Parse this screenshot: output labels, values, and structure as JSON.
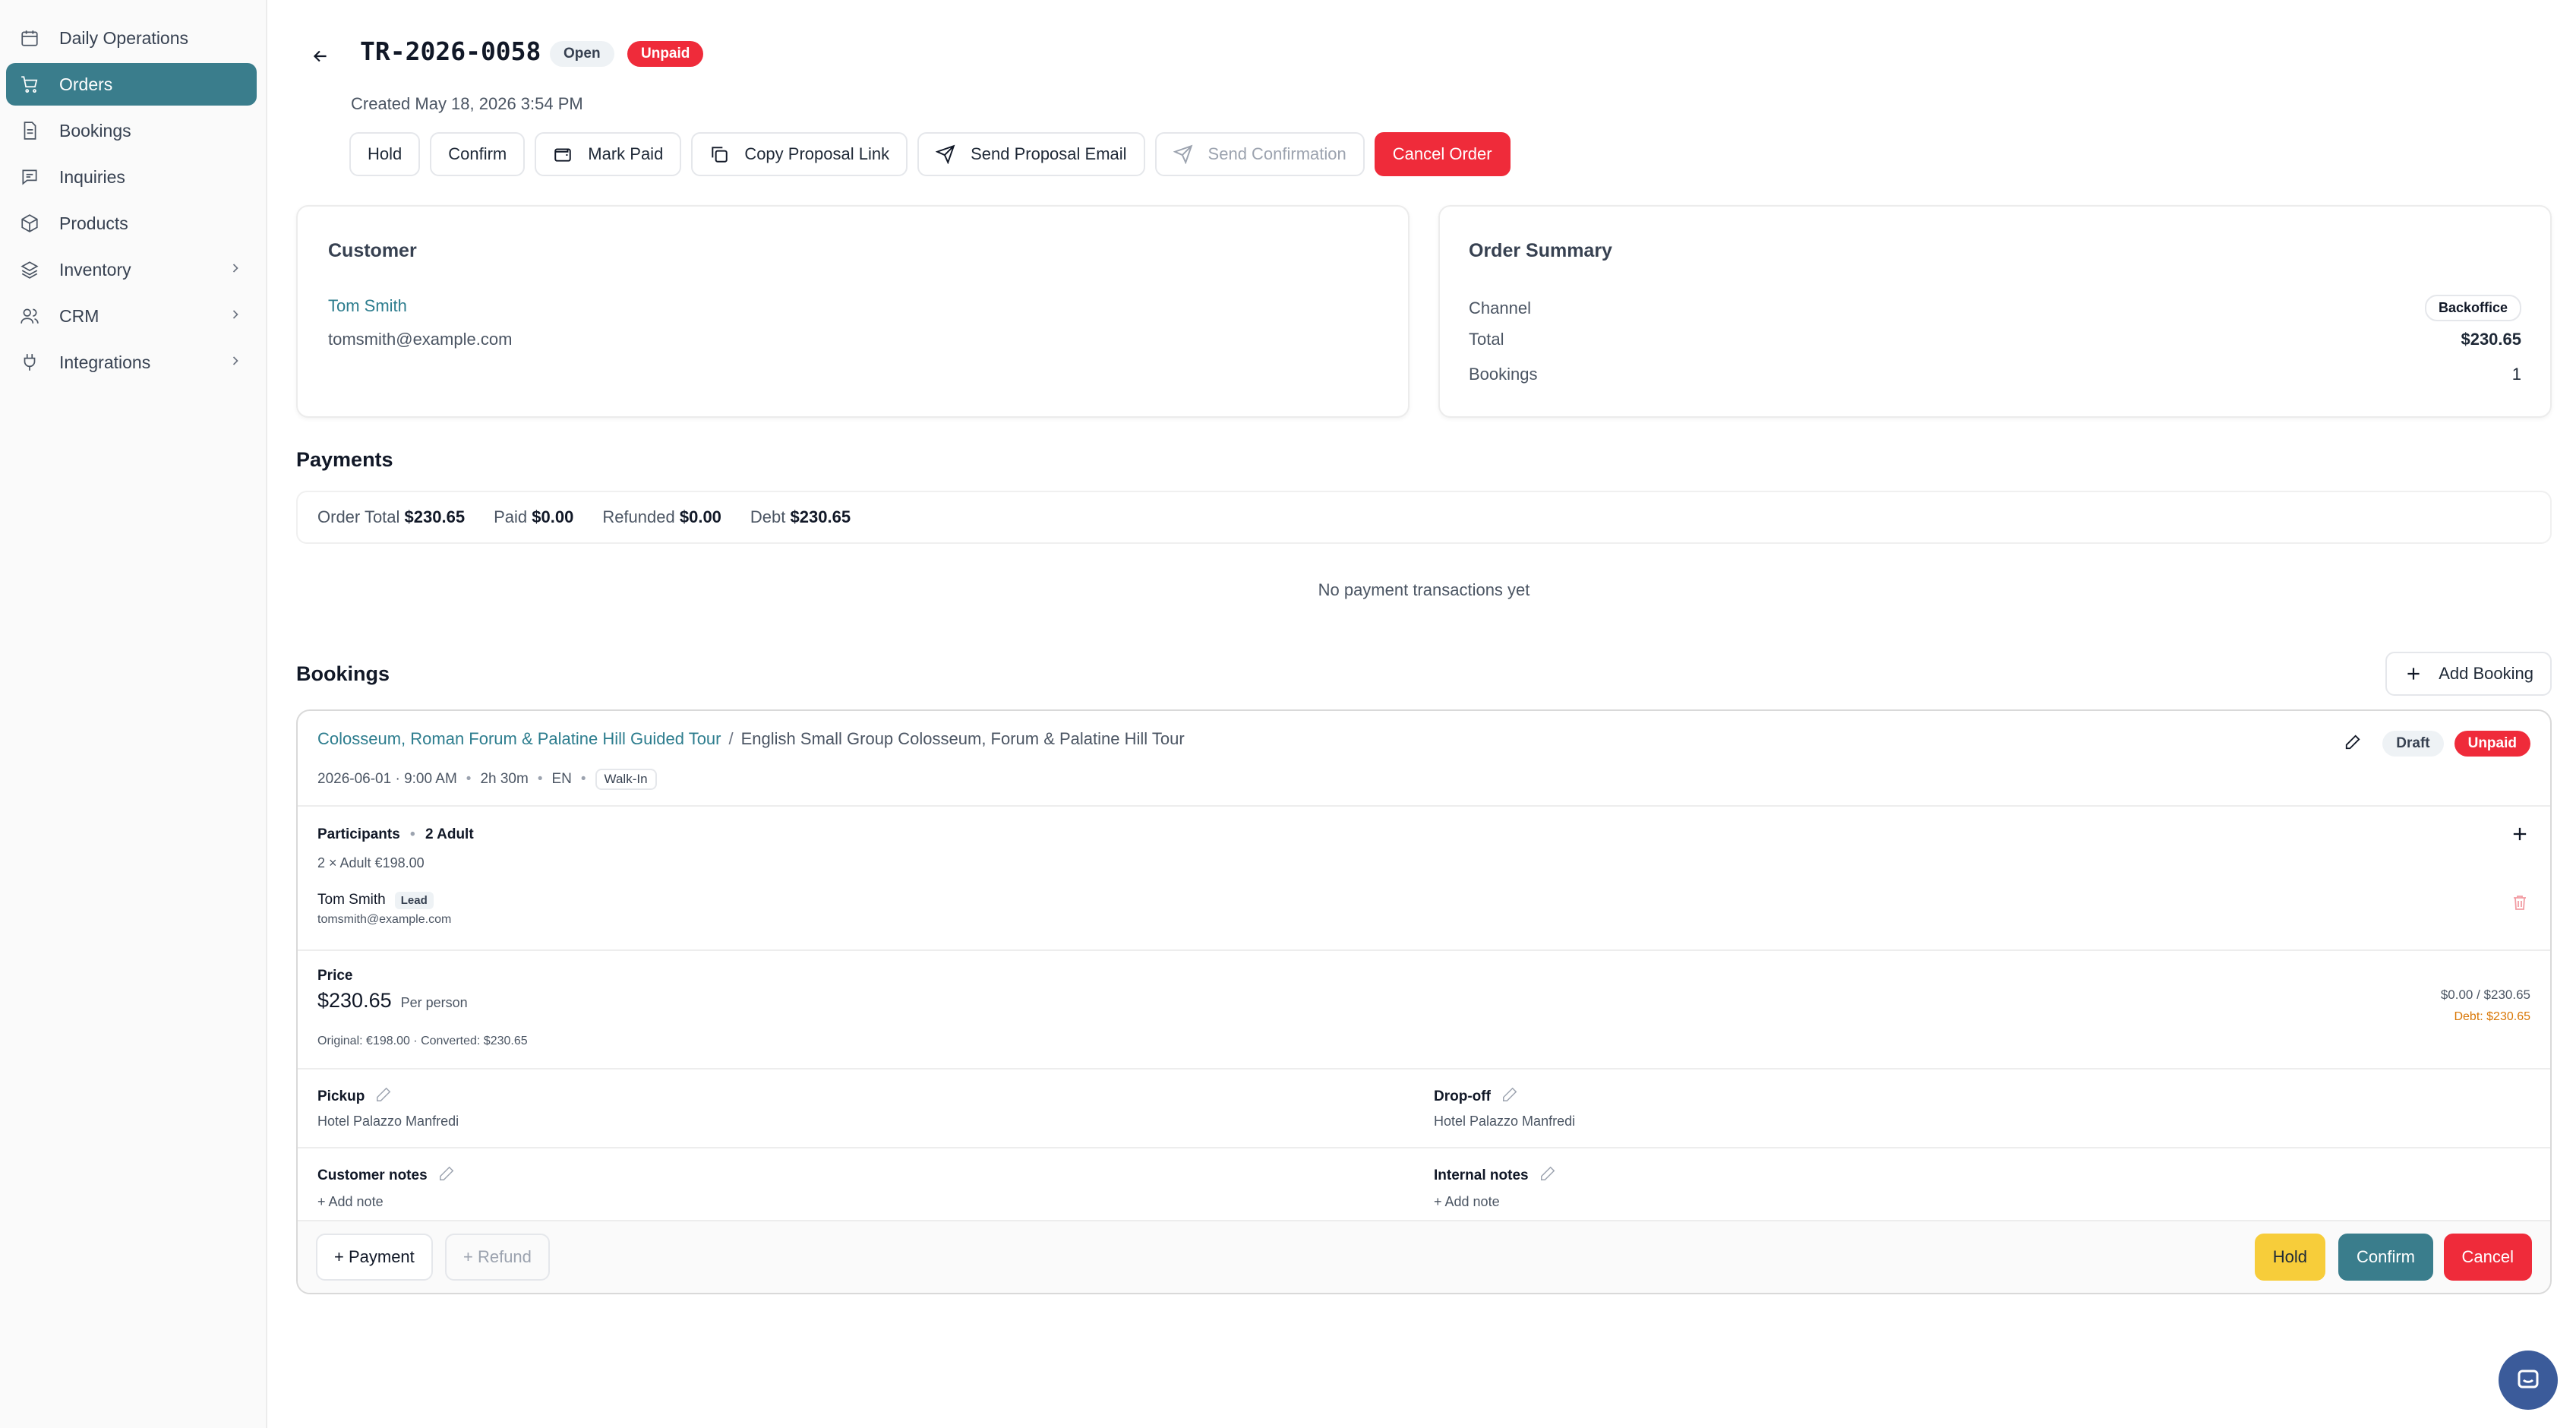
{
  "sidebar": {
    "items": [
      {
        "label": "Daily Operations",
        "icon": "calendar-icon"
      },
      {
        "label": "Orders",
        "icon": "cart-icon",
        "active": true
      },
      {
        "label": "Bookings",
        "icon": "document-icon"
      },
      {
        "label": "Inquiries",
        "icon": "message-icon"
      },
      {
        "label": "Products",
        "icon": "package-icon"
      },
      {
        "label": "Inventory",
        "icon": "layers-icon"
      },
      {
        "label": "CRM",
        "icon": "users-icon"
      },
      {
        "label": "Integrations",
        "icon": "plug-icon"
      }
    ]
  },
  "header": {
    "title": "TR-2026-0058",
    "status_badge": "Open",
    "payment_badge": "Unpaid",
    "created": "Created May 18, 2026 3:54 PM"
  },
  "actions": {
    "hold": "Hold",
    "confirm": "Confirm",
    "mark_paid": "Mark Paid",
    "copy_link": "Copy Proposal Link",
    "send_email": "Send Proposal Email",
    "send_confirmation": "Send Confirmation",
    "cancel_order": "Cancel Order"
  },
  "customer": {
    "title": "Customer",
    "name": "Tom Smith",
    "email": "tomsmith@example.com"
  },
  "summary": {
    "title": "Order Summary",
    "channel_label": "Channel",
    "channel_value": "Backoffice",
    "total_label": "Total",
    "total_value": "$230.65",
    "bookings_label": "Bookings",
    "bookings_value": "1"
  },
  "payments": {
    "title": "Payments",
    "order_total_label": "Order Total",
    "order_total_value": "$230.65",
    "paid_label": "Paid",
    "paid_value": "$0.00",
    "refunded_label": "Refunded",
    "refunded_value": "$0.00",
    "debt_label": "Debt",
    "debt_value": "$230.65",
    "empty": "No payment transactions yet"
  },
  "bookings": {
    "title": "Bookings",
    "add_label": "Add Booking",
    "item": {
      "tour_link": "Colosseum, Roman Forum & Palatine Hill Guided Tour",
      "separator": "/",
      "variant": "English Small Group Colosseum, Forum & Palatine Hill Tour",
      "datetime": "2026-06-01 · 9:00 AM",
      "duration": "2h 30m",
      "language": "EN",
      "source": "Walk-In",
      "draft_badge": "Draft",
      "unpaid_badge": "Unpaid",
      "participants_label": "Participants",
      "participants_count": "2 Adult",
      "participants_line": "2 × Adult  €198.00",
      "lead_name": "Tom Smith",
      "lead_badge": "Lead",
      "lead_email": "tomsmith@example.com",
      "price_label": "Price",
      "price_value": "$230.65",
      "price_unit": "Per person",
      "price_note": "Original: €198.00 · Converted: $230.65",
      "paid_ratio": "$0.00 / $230.65",
      "debt_line": "Debt: $230.65",
      "pickup_label": "Pickup",
      "pickup_value": "Hotel Palazzo Manfredi",
      "dropoff_label": "Drop-off",
      "dropoff_value": "Hotel Palazzo Manfredi",
      "customer_notes_label": "Customer notes",
      "customer_notes_add": "+ Add note",
      "internal_notes_label": "Internal notes",
      "internal_notes_add": "+ Add note",
      "payment_btn": "+ Payment",
      "refund_btn": "+ Refund",
      "hold_btn": "Hold",
      "confirm_btn": "Confirm",
      "cancel_btn": "Cancel"
    }
  },
  "colors": {
    "accent": "#3a7d8c",
    "danger": "#ef2b3a",
    "warning": "#f7cd3a",
    "debt_text": "#d97706"
  }
}
